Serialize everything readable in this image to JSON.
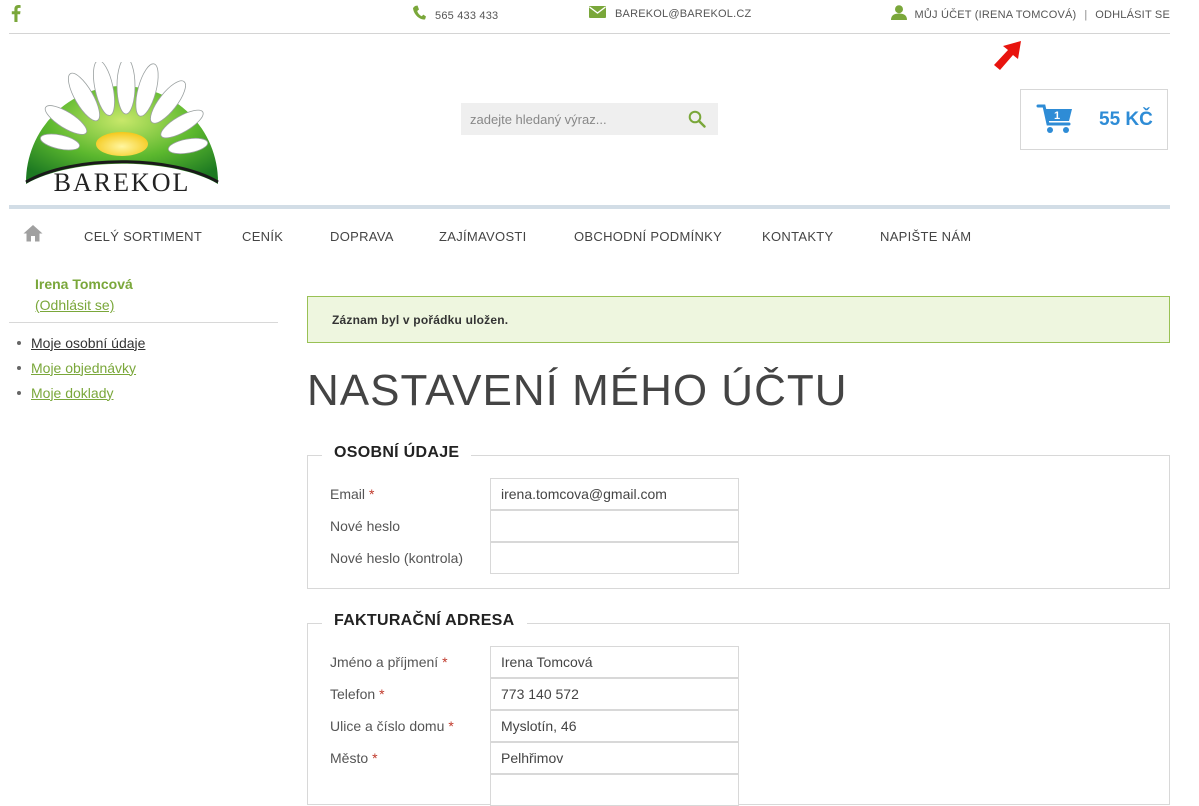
{
  "topbar": {
    "phone": "565 433 433",
    "email": "BAREKOL@BAREKOL.CZ",
    "account": "MŮJ ÚČET (IRENA TOMCOVÁ)",
    "separator": "|",
    "logout": "ODHLÁSIT SE"
  },
  "header": {
    "logo_text": "BAREKOL",
    "search_placeholder": "zadejte hledaný výraz...",
    "cart_count": "1",
    "cart_price": "55 KČ"
  },
  "nav": {
    "items": [
      "CELÝ SORTIMENT",
      "CENÍK",
      "DOPRAVA",
      "ZAJÍMAVOSTI",
      "OBCHODNÍ PODMÍNKY",
      "KONTAKTY",
      "NAPIŠTE NÁM"
    ]
  },
  "sidebar": {
    "user_name": "Irena Tomcová",
    "logout": "(Odhlásit se)",
    "items": [
      "Moje osobní údaje",
      "Moje objednávky",
      "Moje doklady"
    ]
  },
  "main": {
    "alert": "Záznam byl v pořádku uložen.",
    "title": "NASTAVENÍ MÉHO ÚČTU",
    "personal": {
      "legend": "OSOBNÍ ÚDAJE",
      "fields": [
        {
          "label": "Email",
          "required": "*",
          "value": "irena.tomcova@gmail.com"
        },
        {
          "label": "Nové heslo",
          "required": "",
          "value": ""
        },
        {
          "label": "Nové heslo (kontrola)",
          "required": "",
          "value": ""
        }
      ]
    },
    "billing": {
      "legend": "FAKTURAČNÍ ADRESA",
      "fields": [
        {
          "label": "Jméno a příjmení",
          "required": "*",
          "value": "Irena Tomcová"
        },
        {
          "label": "Telefon",
          "required": "*",
          "value": "773 140 572"
        },
        {
          "label": "Ulice a číslo domu",
          "required": "*",
          "value": "Myslotín, 46"
        },
        {
          "label": "Město",
          "required": "*",
          "value": "Pelhřimov"
        },
        {
          "label": "",
          "required": "",
          "value": ""
        }
      ]
    }
  },
  "colors": {
    "green": "#7aa73a",
    "blue": "#2e8cd6",
    "alert_bg": "#eef6df",
    "arrow_red": "#e8140e"
  }
}
